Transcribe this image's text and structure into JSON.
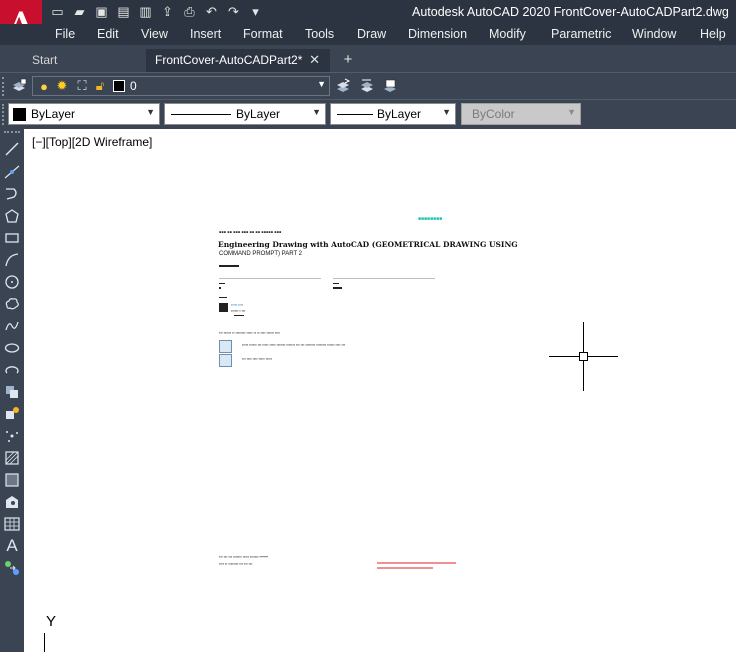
{
  "app": {
    "logo_letter": "A",
    "window_title": "Autodesk AutoCAD 2020    FrontCover-AutoCADPart2.dwg"
  },
  "quick_access": [
    {
      "name": "new-icon",
      "glyph": "▭"
    },
    {
      "name": "open-icon",
      "glyph": "▰"
    },
    {
      "name": "save-icon",
      "glyph": "▣"
    },
    {
      "name": "saveas-icon",
      "glyph": "▤"
    },
    {
      "name": "plot-preview-icon",
      "glyph": "▥"
    },
    {
      "name": "publish-icon",
      "glyph": "⇪"
    },
    {
      "name": "print-icon",
      "glyph": "⎙"
    },
    {
      "name": "undo-icon",
      "glyph": "↶"
    },
    {
      "name": "redo-icon",
      "glyph": "↷"
    },
    {
      "name": "customize-icon",
      "glyph": "▾"
    }
  ],
  "menu": [
    "File",
    "Edit",
    "View",
    "Insert",
    "Format",
    "Tools",
    "Draw",
    "Dimension",
    "Modify",
    "Parametric",
    "Window",
    "Help"
  ],
  "tabs": {
    "start": "Start",
    "drawing": "FrontCover-AutoCADPart2*",
    "close_glyph": "✕",
    "new_glyph": "+"
  },
  "layer": {
    "current": "0",
    "icons": [
      "layer-properties-icon",
      "bulb-icon",
      "sun-icon",
      "freeze-viewport-icon",
      "lock-icon"
    ]
  },
  "properties": {
    "color": "ByLayer",
    "linetype": "ByLayer",
    "lineweight": "ByLayer",
    "plotstyle": "ByColor"
  },
  "viewport": {
    "label": "[−][Top][2D Wireframe]"
  },
  "ucs": {
    "y_label": "Y"
  },
  "colors": {
    "title_bar": "#2b3440",
    "toolbar": "#3b4453",
    "logo_red": "#c8102e",
    "canvas": "#ffffff",
    "badge_teal": "#15c2b0"
  },
  "document": {
    "title": "Engineering Drawing with AutoCAD (GEOMETRICAL DRAWING USING",
    "subtitle": "COMMAND PROMPT) PART 2"
  }
}
